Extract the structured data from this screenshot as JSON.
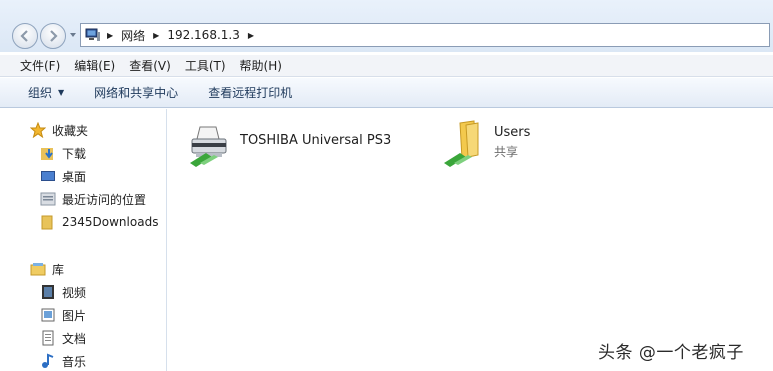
{
  "address": {
    "segments": [
      "网络",
      "192.168.1.3"
    ]
  },
  "menu": [
    "文件(F)",
    "编辑(E)",
    "查看(V)",
    "工具(T)",
    "帮助(H)"
  ],
  "toolbar": {
    "organize": "组织",
    "network_center": "网络和共享中心",
    "view_printers": "查看远程打印机"
  },
  "nav": {
    "favorites": "收藏夹",
    "downloads": "下载",
    "desktop": "桌面",
    "recent": "最近访问的位置",
    "downloads2345": "2345Downloads",
    "library": "库",
    "videos": "视频",
    "pictures": "图片",
    "documents": "文档",
    "music": "音乐"
  },
  "items": [
    {
      "name": "TOSHIBA Universal PS3",
      "subtitle": "",
      "icon": "printer-shared-icon"
    },
    {
      "name": "Users",
      "subtitle": "共享",
      "icon": "folder-shared-icon"
    }
  ],
  "watermark": "头条 @一个老疯子",
  "colors": {
    "chrome_bg": "#dbe7f5",
    "toolbar_text": "#1e395b",
    "share_green": "#3aa63a",
    "folder_yellow": "#f3c94d"
  }
}
